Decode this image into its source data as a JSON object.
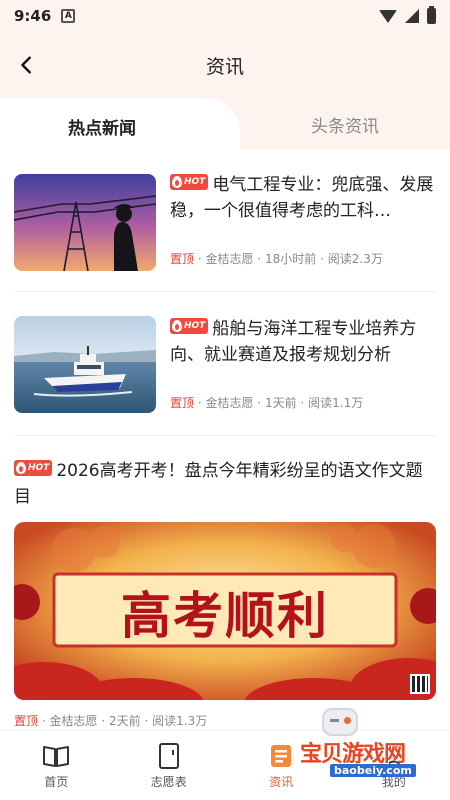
{
  "status_bar": {
    "time": "9:46",
    "notification_icon": "A"
  },
  "header": {
    "title": "资讯",
    "back_icon": "chevron-left-icon"
  },
  "tabs": [
    {
      "label": "热点新闻",
      "active": true
    },
    {
      "label": "头条资讯",
      "active": false
    }
  ],
  "hot_badge": "HOT",
  "articles": [
    {
      "title": "电气工程专业：兜底强、发展稳，一个很值得考虑的工科…",
      "pin": "置顶",
      "source": "金桔志愿",
      "time": "18小时前",
      "reads": "阅读2.3万",
      "image": "power-tower-photo"
    },
    {
      "title": "船舶与海洋工程专业培养方向、就业赛道及报考规划分析",
      "pin": "置顶",
      "source": "金桔志愿",
      "time": "1天前",
      "reads": "阅读1.1万",
      "image": "ship-photo"
    },
    {
      "title": "2026高考开考！盘点今年精彩纷呈的语文作文题目",
      "pin": "置顶",
      "source": "金桔志愿",
      "time": "2天前",
      "reads": "阅读1.3万",
      "image": "gaokao-banner"
    }
  ],
  "banner_text": "高考顺利",
  "meta_sep": "·",
  "bottom_nav": [
    {
      "label": "首页",
      "icon": "book-icon",
      "active": false
    },
    {
      "label": "志愿表",
      "icon": "form-icon",
      "active": false
    },
    {
      "label": "资讯",
      "icon": "news-icon",
      "active": true
    },
    {
      "label": "我的",
      "icon": "profile-icon",
      "active": false
    }
  ],
  "watermark": {
    "text": "宝贝游戏网",
    "url": "baobeiy.com"
  },
  "colors": {
    "accent": "#e85c2c",
    "pin_red": "#e0443c",
    "hot_red": "#ef4a3c",
    "header_bg": "#fdf4ef"
  }
}
